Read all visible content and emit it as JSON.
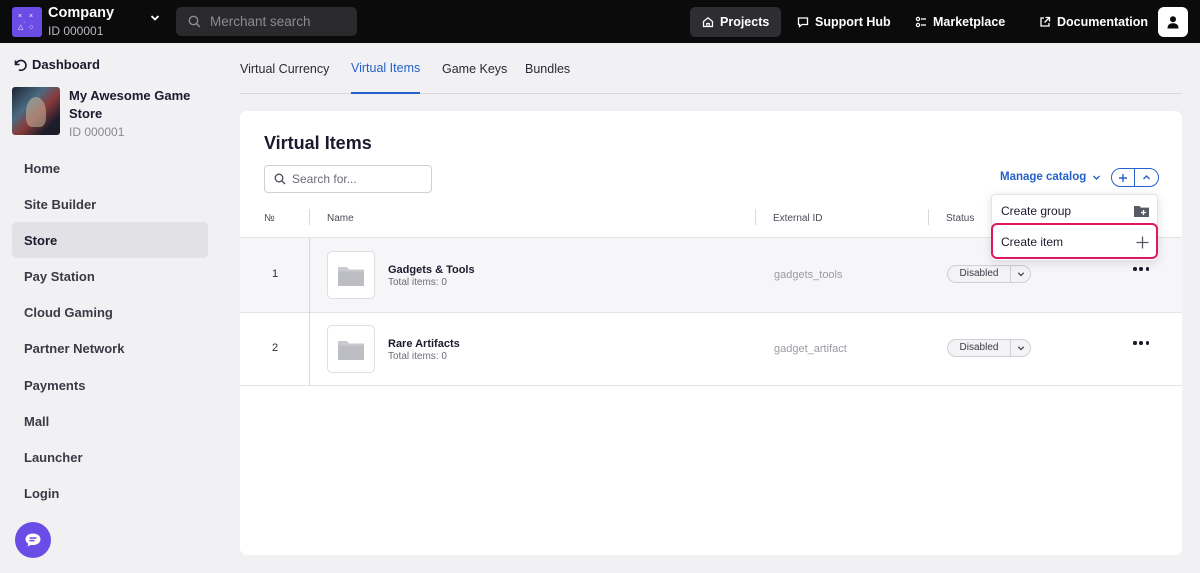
{
  "topbar": {
    "company_name": "Company",
    "company_id": "ID 000001",
    "search_placeholder": "Merchant search",
    "nav": [
      {
        "label": "Projects",
        "icon": "home-icon",
        "active": true
      },
      {
        "label": "Support Hub",
        "icon": "chat-icon"
      },
      {
        "label": "Marketplace",
        "icon": "grid-icon"
      },
      {
        "label": "Documentation",
        "icon": "external-link-icon"
      }
    ],
    "avatar_icon": "user-icon"
  },
  "sidebar": {
    "back_label": "Dashboard",
    "project_name": "My Awesome Game Store",
    "project_id": "ID 000001",
    "items": [
      {
        "label": "Home"
      },
      {
        "label": "Site Builder"
      },
      {
        "label": "Store",
        "active": true
      },
      {
        "label": "Pay Station"
      },
      {
        "label": "Cloud Gaming"
      },
      {
        "label": "Partner Network"
      },
      {
        "label": "Payments"
      },
      {
        "label": "Mall"
      },
      {
        "label": "Launcher"
      },
      {
        "label": "Login"
      }
    ]
  },
  "tabs": [
    {
      "label": "Virtual Currency"
    },
    {
      "label": "Virtual Items",
      "active": true
    },
    {
      "label": "Game Keys"
    },
    {
      "label": "Bundles"
    }
  ],
  "main": {
    "title": "Virtual Items",
    "search_placeholder": "Search for...",
    "manage_catalog_label": "Manage catalog",
    "table": {
      "columns": [
        "№",
        "Name",
        "External ID",
        "Status"
      ],
      "rows": [
        {
          "num": "1",
          "name": "Gadgets & Tools",
          "sub": "Total items: 0",
          "external_id": "gadgets_tools",
          "status": "Disabled"
        },
        {
          "num": "2",
          "name": "Rare Artifacts",
          "sub": "Total items: 0",
          "external_id": "gadget_artifact",
          "status": "Disabled"
        }
      ]
    },
    "dropdown": {
      "items": [
        {
          "label": "Create group",
          "icon": "folder-plus-icon"
        },
        {
          "label": "Create item",
          "icon": "plus-icon",
          "highlighted": true
        }
      ]
    }
  },
  "colors": {
    "accent": "#2561c9",
    "brand": "#6b4de6",
    "highlight": "#e0175e",
    "topbar": "#0b0b0c"
  }
}
